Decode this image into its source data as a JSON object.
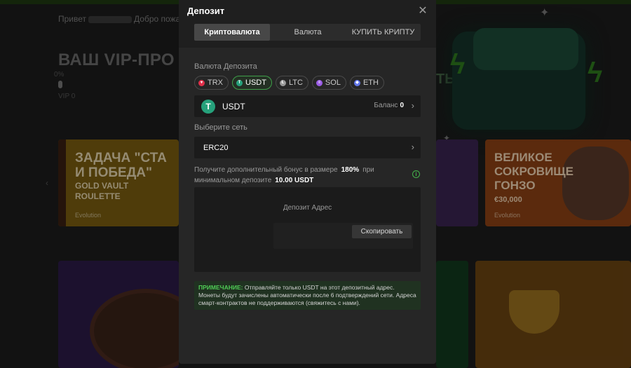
{
  "background": {
    "greeting_prefix": "Привет",
    "greeting_suffix": "Добро пожалов",
    "vip_title": "ВАШ VIP-ПРО",
    "vip_title_right": "ТЬ",
    "vip_progress_percent": "0%",
    "vip_progress_value": 0,
    "vip_level": "VIP 0",
    "tiles": {
      "gold": {
        "title_line1": "ЗАДАЧА \"СТА",
        "title_line2": "И ПОБЕДА\"",
        "game_line1": "GOLD VAULT",
        "game_line2": "ROULETTE",
        "provider": "Evolution"
      },
      "orange": {
        "title_line1": "ВЕЛИКОЕ",
        "title_line2": "СОКРОВИЩЕ",
        "title_line3": "ГОНЗО",
        "prize": "€30,000",
        "provider": "Evolution"
      }
    }
  },
  "modal": {
    "title": "Депозит",
    "tabs": [
      {
        "label": "Криптовалюта",
        "active": true
      },
      {
        "label": "Валюта",
        "active": false
      },
      {
        "label": "КУПИТЬ КРИПТУ",
        "active": false
      }
    ],
    "currency_label": "Валюта Депозита",
    "currencies": [
      {
        "code": "TRX",
        "color": "#e0304a",
        "selected": false
      },
      {
        "code": "USDT",
        "color": "#26a17b",
        "selected": true
      },
      {
        "code": "LTC",
        "color": "#9a9a9a",
        "selected": false
      },
      {
        "code": "SOL",
        "color": "#9b5de5",
        "selected": false
      },
      {
        "code": "ETH",
        "color": "#6276e8",
        "selected": false
      }
    ],
    "selected_coin": {
      "name": "USDT",
      "balance_label": "Баланс",
      "balance_value": "0"
    },
    "network_label": "Выберите сеть",
    "network_value": "ERC20",
    "bonus": {
      "text_before": "Получите дополнительный бонус в размере",
      "percent": "180%",
      "text_middle_1": "при",
      "text_middle_2": "минимальном депозите",
      "min_deposit": "10.00 USDT"
    },
    "address": {
      "label": "Депозит Адрес",
      "copy_button": "Скопировать"
    },
    "note": {
      "key": "ПРИМЕЧАНИЕ:",
      "text": "Отправляйте только USDT на этот депозитный адрес. Монеты будут зачислены автоматически после 6 подтверждений сети. Адреса смарт-контрактов не поддерживаются (свяжитесь с нами)."
    }
  },
  "colors": {
    "accent_green": "#43b14a",
    "modal_bg": "#1f1f1f",
    "panel_bg": "#262626",
    "field_bg": "#1b1b1b"
  }
}
